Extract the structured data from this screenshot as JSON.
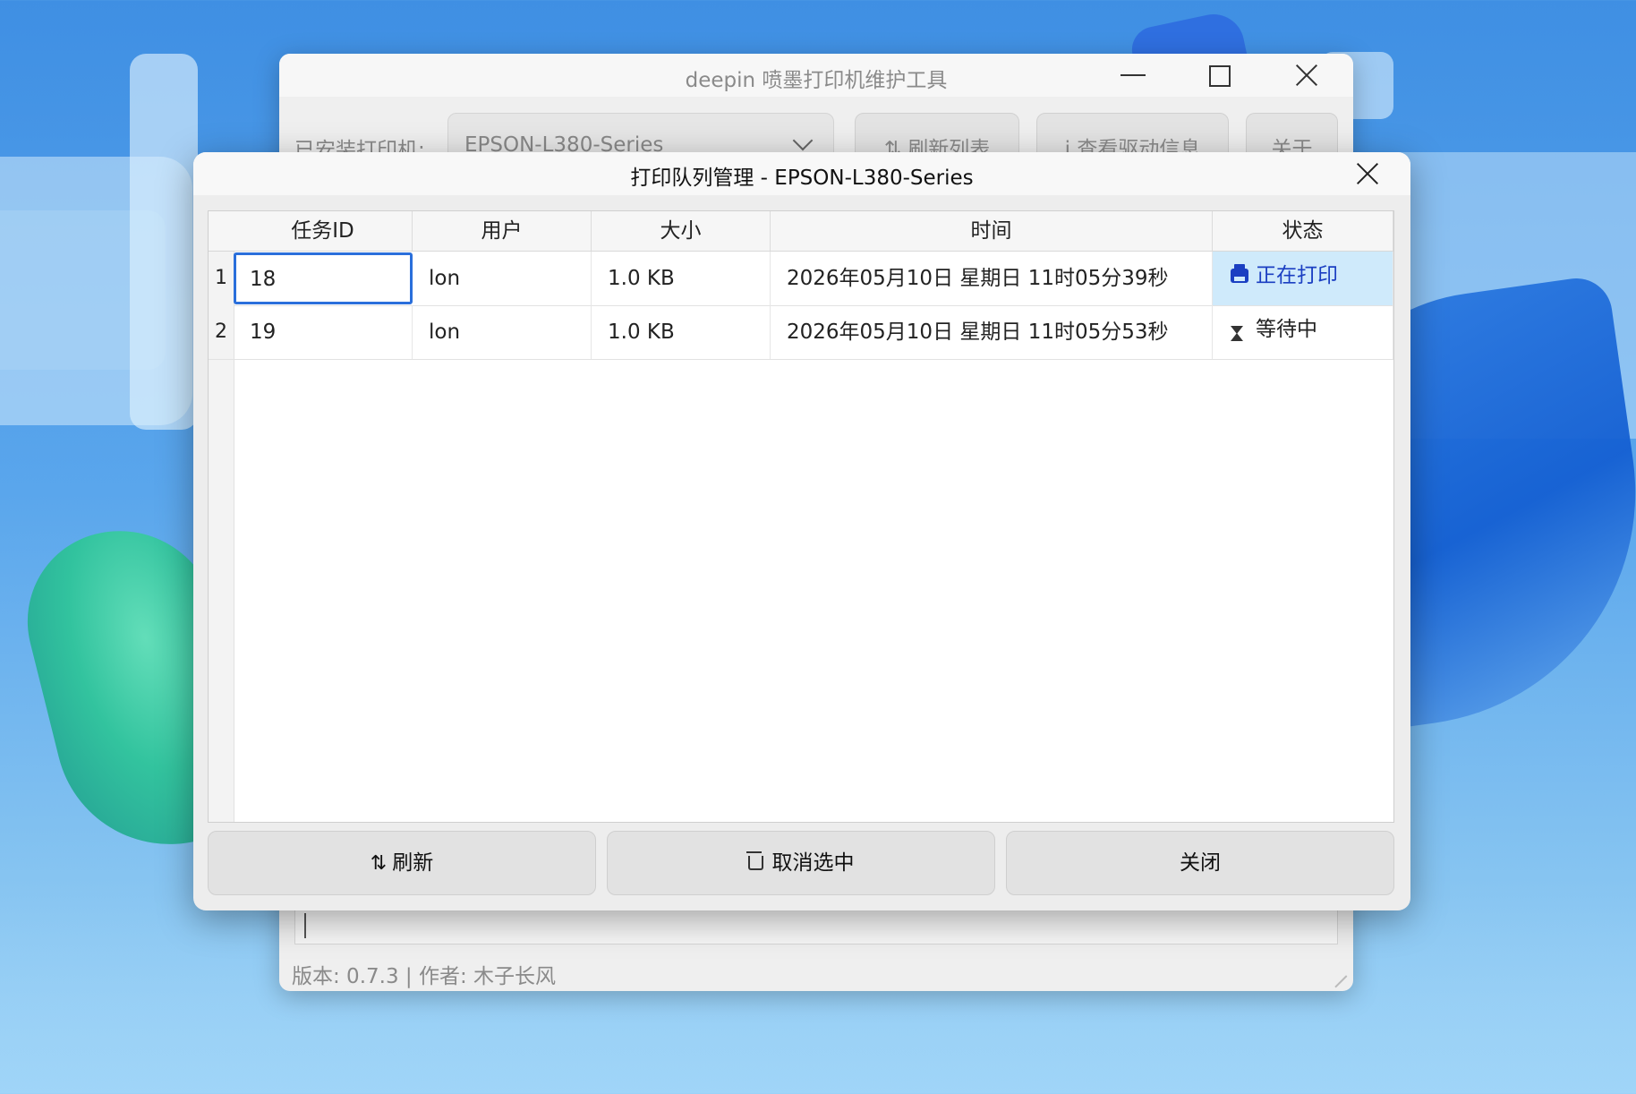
{
  "main_window": {
    "title": "deepin 喷墨打印机维护工具",
    "printer_label": "已安装打印机:",
    "printer_selected": "EPSON-L380-Series",
    "buttons": {
      "refresh_list": "⇅ 刷新列表",
      "driver_info": "i 查看驱动信息",
      "about": "关于"
    },
    "status_bar": "版本: 0.7.3 | 作者: 木子长风"
  },
  "dialog": {
    "title": "打印队列管理 - EPSON-L380-Series",
    "columns": [
      "任务ID",
      "用户",
      "大小",
      "时间",
      "状态"
    ],
    "rows": [
      {
        "num": "1",
        "id": "18",
        "user": "lon",
        "size": "1.0 KB",
        "time": "2026年05月10日 星期日 11时05分39秒",
        "status": "正在打印",
        "status_icon": "printer-icon"
      },
      {
        "num": "2",
        "id": "19",
        "user": "lon",
        "size": "1.0 KB",
        "time": "2026年05月10日 星期日 11时05分53秒",
        "status": "等待中",
        "status_icon": "hourglass-icon"
      }
    ],
    "buttons": {
      "refresh": "刷新",
      "cancel_selected": "取消选中",
      "close": "关闭"
    }
  },
  "colors": {
    "accent": "#2a6fdb",
    "active_row_bg": "#cfeafb",
    "active_text": "#1b3fc2"
  }
}
